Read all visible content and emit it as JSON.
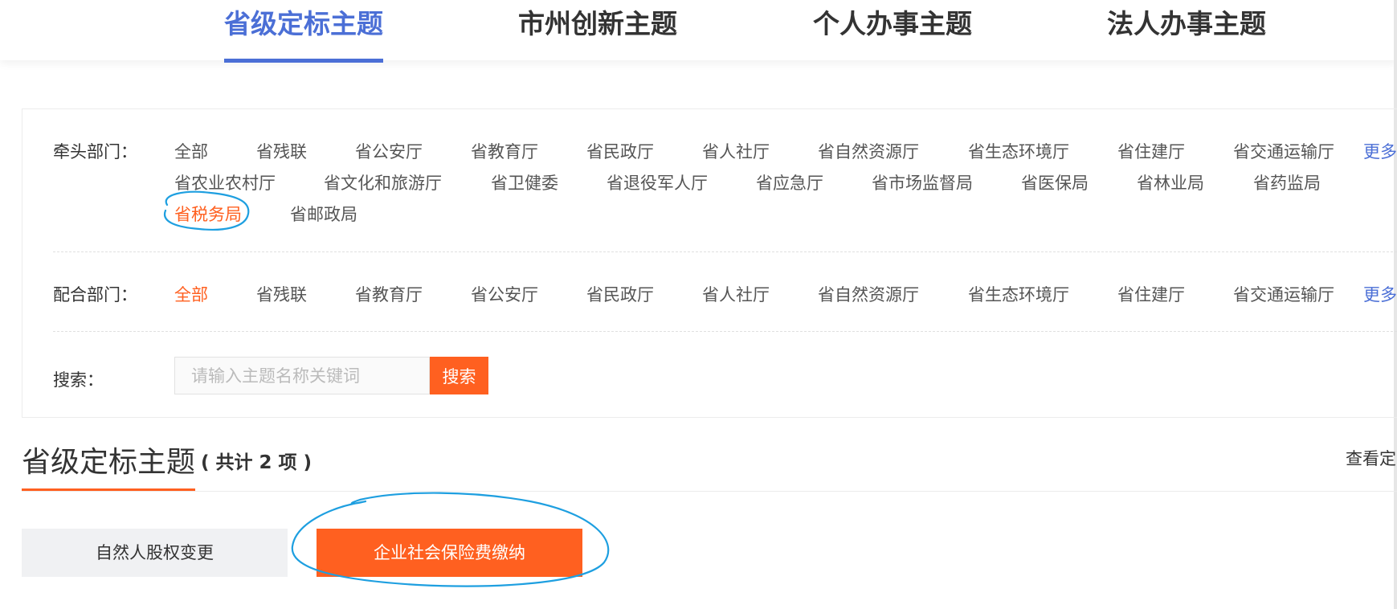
{
  "tabs": [
    {
      "label": "省级定标主题",
      "active": true
    },
    {
      "label": "市州创新主题",
      "active": false
    },
    {
      "label": "个人办事主题",
      "active": false
    },
    {
      "label": "法人办事主题",
      "active": false
    }
  ],
  "lead_dept": {
    "label": "牵头部门：",
    "options": [
      "全部",
      "省残联",
      "省公安厅",
      "省教育厅",
      "省民政厅",
      "省人社厅",
      "省自然资源厅",
      "省生态环境厅",
      "省住建厅",
      "省交通运输厅",
      "省农业农村厅",
      "省文化和旅游厅",
      "省卫健委",
      "省退役军人厅",
      "省应急厅",
      "省市场监督局",
      "省医保局",
      "省林业局",
      "省药监局",
      "省税务局",
      "省邮政局"
    ],
    "selected": "省税务局",
    "more": "更多"
  },
  "coop_dept": {
    "label": "配合部门：",
    "options": [
      "全部",
      "省残联",
      "省教育厅",
      "省公安厅",
      "省民政厅",
      "省人社厅",
      "省自然资源厅",
      "省生态环境厅",
      "省住建厅",
      "省交通运输厅"
    ],
    "selected": "全部",
    "more": "更多"
  },
  "search": {
    "label": "搜索：",
    "placeholder": "请输入主题名称关键词",
    "button": "搜索"
  },
  "section": {
    "title": "省级定标主题",
    "count": "( 共计 2 项 )",
    "link": "查看定"
  },
  "results": [
    {
      "label": "自然人股权变更",
      "highlighted": false
    },
    {
      "label": "企业社会保险费缴纳",
      "highlighted": true
    }
  ],
  "colors": {
    "accent_blue": "#4b6fd6",
    "accent_orange": "#ff6020",
    "annotation": "#1e9fe0"
  }
}
